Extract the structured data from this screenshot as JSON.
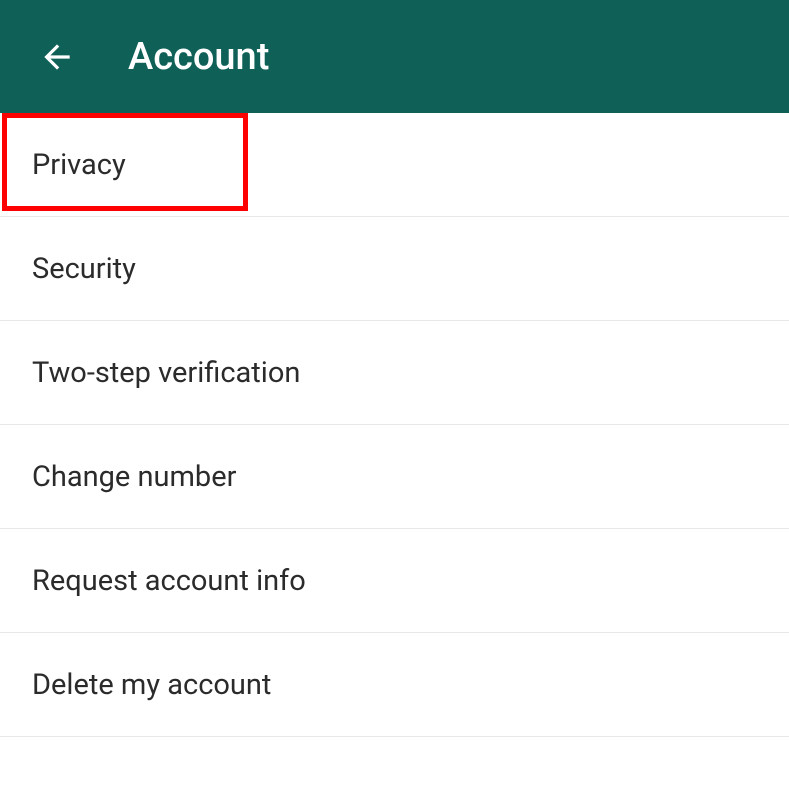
{
  "header": {
    "title": "Account"
  },
  "menu": {
    "items": [
      {
        "label": "Privacy"
      },
      {
        "label": "Security"
      },
      {
        "label": "Two-step verification"
      },
      {
        "label": "Change number"
      },
      {
        "label": "Request account info"
      },
      {
        "label": "Delete my account"
      }
    ]
  }
}
